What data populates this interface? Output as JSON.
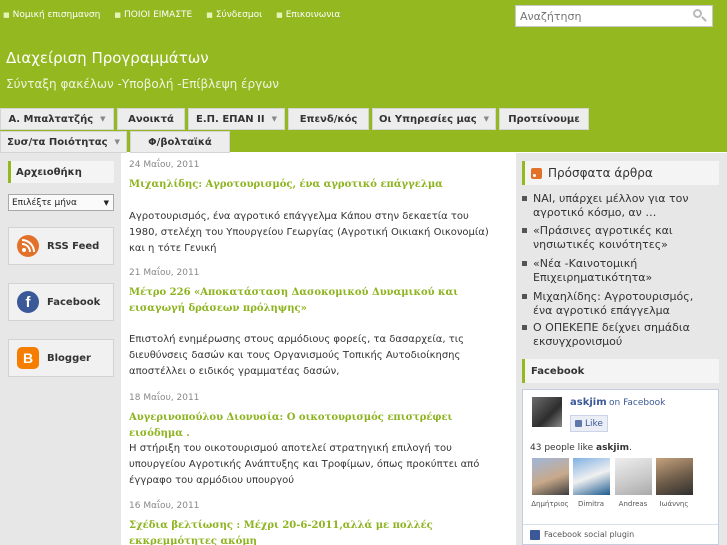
{
  "toplinks": [
    "Νομική επισημανση",
    "ΠΟΙΟΙ ΕΙΜΑΣΤΕ",
    "Σύνδεσμοι",
    "Επικοινωνια"
  ],
  "search": {
    "placeholder": "Αναζήτηση"
  },
  "site": {
    "title": "Διαχείριση Προγραμμάτων",
    "description": "Σύνταξη φακέλων -Υποβολή -Επίβλεψη έργων"
  },
  "nav": {
    "row1": [
      {
        "label": "Α. Μπαλτατζής",
        "dropdown": true
      },
      {
        "label": "Ανοικτά",
        "dropdown": false
      },
      {
        "label": "Ε.Π. ΕΠΑΝ ΙΙ",
        "dropdown": true
      },
      {
        "label": "Επενδ/κός",
        "dropdown": false
      },
      {
        "label": "Οι Υπηρεσίες μας",
        "dropdown": true
      },
      {
        "label": "Προτείνουμε",
        "dropdown": false
      }
    ],
    "row2": [
      {
        "label": "Συσ/τα Ποιότητας",
        "dropdown": true
      },
      {
        "label": "Φ/βολταϊκά",
        "dropdown": false
      }
    ]
  },
  "left_sidebar": {
    "archive_title": "Αρχειοθήκη",
    "archive_select": "Επιλέξτε μήνα",
    "buttons": [
      {
        "label": "RSS Feed",
        "icon": "rss-icon"
      },
      {
        "label": "Facebook",
        "icon": "facebook-icon"
      },
      {
        "label": "Blogger",
        "icon": "blogger-icon"
      }
    ]
  },
  "posts": [
    {
      "date": "24 Μαΐου, 2011",
      "title": "Μιχαηλίδης: Αγροτουρισμός, ένα αγροτικό επάγγελμα",
      "body": "Αγροτουρισμός, ένα αγροτικό επάγγελμα Κάπου στην δεκαετία του 1980, στελέχη του Υπουργείου Γεωργίας (Αγροτική Οικιακή Οικονομία) και η τότε Γενική"
    },
    {
      "date": "21 Μαΐου, 2011",
      "title": "Μέτρο 226 «Αποκατάσταση Δασοκομικού Δυναμικού και εισαγωγή δράσεων πρόληψης»",
      "body": "Επιστολή ενημέρωσης στους αρμόδιους φορείς, τα δασαρχεία, τις διευθύνσεις δασών και τους Οργανισμούς Τοπικής Αυτοδιοίκησης αποστέλλει ο ειδικός γραμματέας δασών,"
    },
    {
      "date": "18 Μαΐου, 2011",
      "title": "Αυγερινοπούλου Διονυσία: Ο οικοτουρισμός επιστρέφει εισόδημα .",
      "body": "Η στήριξη του οικοτουρισμού αποτελεί στρατηγική επιλογή του υπουργείου Αγροτικής Ανάπτυξης και Τροφίμων, όπως προκύπτει από έγγραφο του αρμόδιου υπουργού"
    },
    {
      "date": "16 Μαΐου, 2011",
      "title": "Σχέδια βελτίωσης : Μέχρι 20-6-2011,αλλά με πολλές εκκρεμμότητες ακόμη",
      "body": ""
    }
  ],
  "right_sidebar": {
    "recent_title": "Πρόσφατα άρθρα",
    "recent_items": [
      "ΝΑΙ, υπάρχει μέλλον για τον αγροτικό κόσμο, αν …",
      "«Πράσινες αγροτικές και νησιωτικές κοινότητες»",
      "«Νέα -Καινοτομική Επιχειρηματικότητα»",
      "Μιχαηλίδης: Αγροτουρισμός, ένα αγροτικό επάγγελμα",
      "Ο ΟΠΕΚΕΠΕ δείχνει σημάδια εκσυγχρονισμού"
    ],
    "facebook_title": "Facebook",
    "fb_widget": {
      "page_name": "askjim",
      "on_facebook": "on Facebook",
      "like_label": "Like",
      "count_prefix": "43 people like",
      "count_name": "askjim",
      "count_suffix": ".",
      "faces": [
        "Δημήτριος",
        "Dimitra",
        "Andreas",
        "Ιωάννης"
      ],
      "footer": "Facebook social plugin"
    }
  },
  "colors": {
    "header_green": "#94b820",
    "title_green": "#8db31e",
    "facebook_blue": "#3b5998"
  }
}
